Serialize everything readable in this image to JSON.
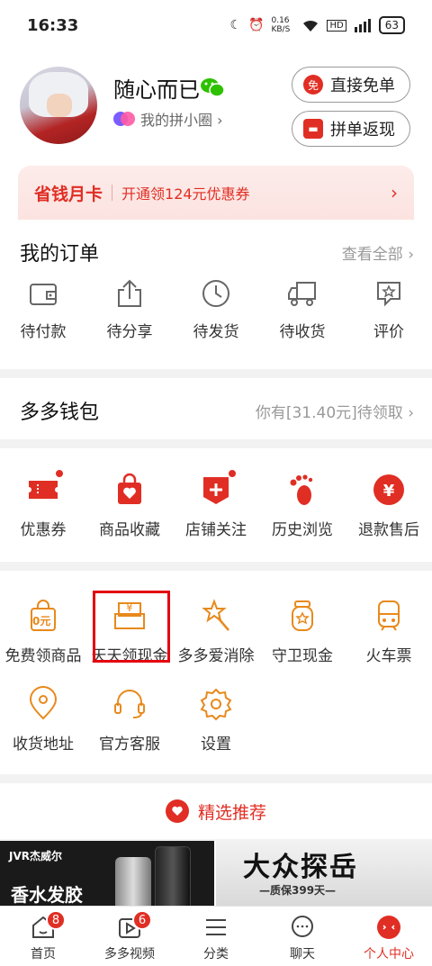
{
  "status_bar": {
    "time": "16:33",
    "net_speed": "0.16 KB/S",
    "battery": "63"
  },
  "profile": {
    "username": "随心而已",
    "circle_link": "我的拼小圈 ›",
    "free_order_button": "直接免单",
    "free_order_icon_text": "免",
    "cashback_button": "拼单返现"
  },
  "savings_card": {
    "title": "省钱月卡",
    "description": "开通领124元优惠券",
    "arrow": "›"
  },
  "orders": {
    "title": "我的订单",
    "view_all": "查看全部 ›",
    "items": [
      {
        "label": "待付款",
        "icon": "wallet-icon"
      },
      {
        "label": "待分享",
        "icon": "share-icon"
      },
      {
        "label": "待发货",
        "icon": "clock-icon"
      },
      {
        "label": "待收货",
        "icon": "truck-icon"
      },
      {
        "label": "评价",
        "icon": "review-icon"
      }
    ]
  },
  "wallet": {
    "title": "多多钱包",
    "pending": "你有[31.40元]待领取 ›"
  },
  "tools_primary": [
    {
      "label": "优惠券",
      "icon": "coupon-icon",
      "dot": true
    },
    {
      "label": "商品收藏",
      "icon": "bag-heart-icon",
      "dot": false
    },
    {
      "label": "店铺关注",
      "icon": "store-plus-icon",
      "dot": true
    },
    {
      "label": "历史浏览",
      "icon": "footprint-icon",
      "dot": false
    },
    {
      "label": "退款售后",
      "icon": "refund-icon",
      "dot": false
    }
  ],
  "tools_secondary_row1": [
    {
      "label": "免费领商品",
      "icon": "free-goods-icon",
      "icon_text": "0元"
    },
    {
      "label": "天天领现金",
      "icon": "daily-cash-icon",
      "icon_text": "¥"
    },
    {
      "label": "多多爱消除",
      "icon": "magic-wand-icon"
    },
    {
      "label": "守卫现金",
      "icon": "guard-cash-icon"
    },
    {
      "label": "火车票",
      "icon": "train-icon"
    }
  ],
  "tools_secondary_row2": [
    {
      "label": "收货地址",
      "icon": "location-icon"
    },
    {
      "label": "官方客服",
      "icon": "headset-icon"
    },
    {
      "label": "设置",
      "icon": "settings-icon"
    }
  ],
  "recommend": {
    "label": "精选推荐"
  },
  "banners": {
    "left": {
      "brand": "JVR杰威尔",
      "text": "香水发胶"
    },
    "right": {
      "title": "大众探岳",
      "subtitle": "—质保399天—"
    }
  },
  "tabbar": [
    {
      "label": "首页",
      "icon": "home-icon",
      "badge": "8"
    },
    {
      "label": "多多视频",
      "icon": "video-icon",
      "badge": "6"
    },
    {
      "label": "分类",
      "icon": "category-icon",
      "badge": null
    },
    {
      "label": "聊天",
      "icon": "chat-icon",
      "badge": null
    },
    {
      "label": "个人中心",
      "icon": "profile-icon",
      "badge": null,
      "active": true
    }
  ],
  "colors": {
    "accent": "#e02e24",
    "orange": "#e8891c",
    "highlight_box": "#e3000f"
  }
}
